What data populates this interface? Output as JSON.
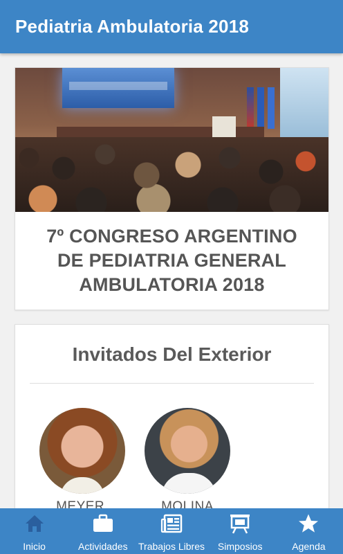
{
  "app": {
    "title": "Pediatria Ambulatoria 2018"
  },
  "hero": {
    "title_lines": [
      "7º CONGRESO ARGENTINO",
      "DE PEDIATRIA GENERAL",
      "AMBULATORIA 2018"
    ]
  },
  "guests": {
    "section_title": "Invitados Del Exterior",
    "items": [
      {
        "name": "MEYER,"
      },
      {
        "name": "MOLINA"
      }
    ]
  },
  "nav": {
    "items": [
      {
        "label": "Inicio",
        "icon": "home-icon",
        "active": true
      },
      {
        "label": "Actividades",
        "icon": "briefcase-icon"
      },
      {
        "label": "Trabajos Libres",
        "icon": "newspaper-icon"
      },
      {
        "label": "Simposios",
        "icon": "easel-icon"
      },
      {
        "label": "Agenda",
        "icon": "star-icon"
      }
    ],
    "active_icon_color": "#2a5f9e",
    "icon_color": "#ffffff"
  },
  "colors": {
    "primary": "#3d85c6",
    "text": "#555555"
  }
}
